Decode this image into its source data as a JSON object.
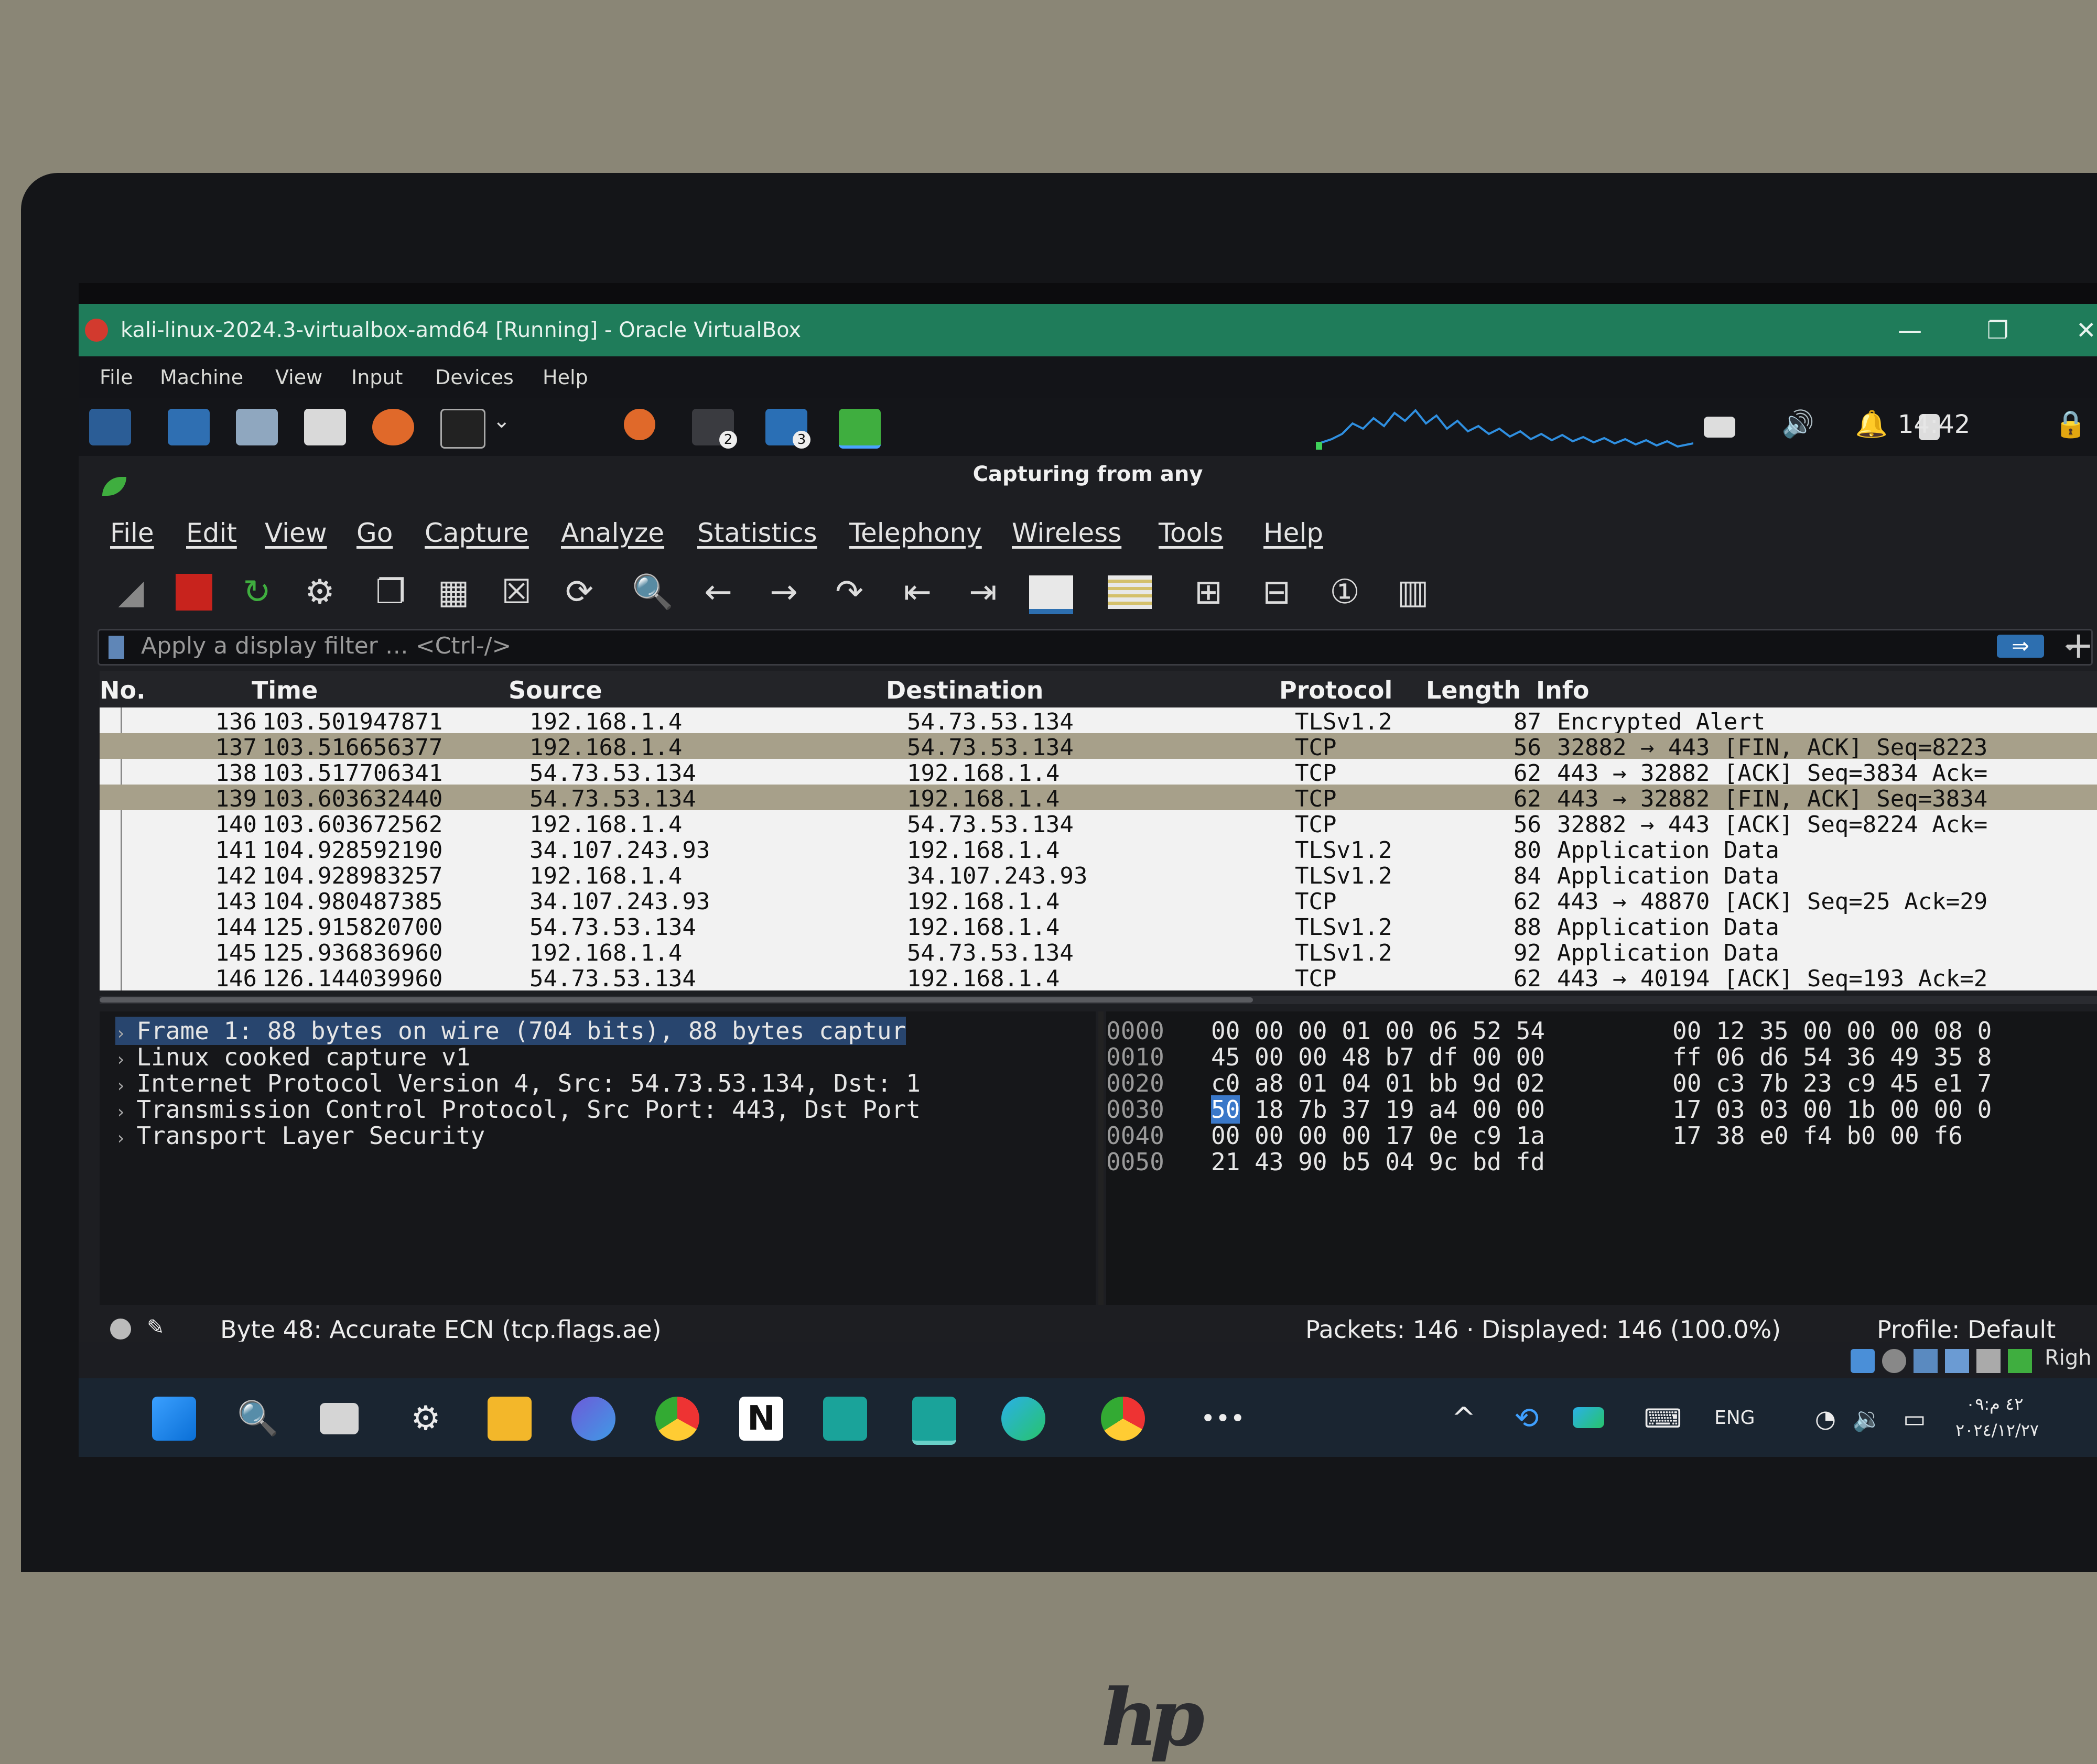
{
  "vbox": {
    "title": "kali-linux-2024.3-virtualbox-amd64 [Running] - Oracle VirtualBox",
    "menu": [
      "File",
      "Machine",
      "View",
      "Input",
      "Devices",
      "Help"
    ],
    "minimize": "—",
    "restore": "❐",
    "close": "✕"
  },
  "kali_panel": {
    "clock": "14:42",
    "workspace_badges": [
      "2",
      "3"
    ]
  },
  "wireshark": {
    "title": "Capturing from any",
    "menu": [
      "File",
      "Edit",
      "View",
      "Go",
      "Capture",
      "Analyze",
      "Statistics",
      "Telephony",
      "Wireless",
      "Tools",
      "Help"
    ],
    "filter_placeholder": "Apply a display filter … <Ctrl-/>",
    "columns": [
      "No.",
      "Time",
      "Source",
      "Destination",
      "Protocol",
      "Length",
      "Info"
    ],
    "packets": [
      {
        "no": "136",
        "time": "103.501947871",
        "src": "192.168.1.4",
        "dst": "54.73.53.134",
        "proto": "TLSv1.2",
        "len": "87",
        "info": "Encrypted Alert"
      },
      {
        "no": "137",
        "time": "103.516656377",
        "src": "192.168.1.4",
        "dst": "54.73.53.134",
        "proto": "TCP",
        "len": "56",
        "info": "32882 → 443 [FIN, ACK] Seq=8223"
      },
      {
        "no": "138",
        "time": "103.517706341",
        "src": "54.73.53.134",
        "dst": "192.168.1.4",
        "proto": "TCP",
        "len": "62",
        "info": "443 → 32882 [ACK] Seq=3834 Ack="
      },
      {
        "no": "139",
        "time": "103.603632440",
        "src": "54.73.53.134",
        "dst": "192.168.1.4",
        "proto": "TCP",
        "len": "62",
        "info": "443 → 32882 [FIN, ACK] Seq=3834"
      },
      {
        "no": "140",
        "time": "103.603672562",
        "src": "192.168.1.4",
        "dst": "54.73.53.134",
        "proto": "TCP",
        "len": "56",
        "info": "32882 → 443 [ACK] Seq=8224 Ack="
      },
      {
        "no": "141",
        "time": "104.928592190",
        "src": "34.107.243.93",
        "dst": "192.168.1.4",
        "proto": "TLSv1.2",
        "len": "80",
        "info": "Application Data"
      },
      {
        "no": "142",
        "time": "104.928983257",
        "src": "192.168.1.4",
        "dst": "34.107.243.93",
        "proto": "TLSv1.2",
        "len": "84",
        "info": "Application Data"
      },
      {
        "no": "143",
        "time": "104.980487385",
        "src": "34.107.243.93",
        "dst": "192.168.1.4",
        "proto": "TCP",
        "len": "62",
        "info": "443 → 48870 [ACK] Seq=25 Ack=29"
      },
      {
        "no": "144",
        "time": "125.915820700",
        "src": "54.73.53.134",
        "dst": "192.168.1.4",
        "proto": "TLSv1.2",
        "len": "88",
        "info": "Application Data"
      },
      {
        "no": "145",
        "time": "125.936836960",
        "src": "192.168.1.4",
        "dst": "54.73.53.134",
        "proto": "TLSv1.2",
        "len": "92",
        "info": "Application Data"
      },
      {
        "no": "146",
        "time": "126.144039960",
        "src": "54.73.53.134",
        "dst": "192.168.1.4",
        "proto": "TCP",
        "len": "62",
        "info": "443 → 40194 [ACK] Seq=193 Ack=2"
      }
    ],
    "details": [
      "Frame 1: 88 bytes on wire (704 bits), 88 bytes captur",
      "Linux cooked capture v1",
      "Internet Protocol Version 4, Src: 54.73.53.134, Dst: 1",
      "Transmission Control Protocol, Src Port: 443, Dst Port",
      "Transport Layer Security"
    ],
    "bytes": [
      {
        "offset": "0000",
        "hex1": "00 00 00 01 00 06 52 54",
        "hex2": "00 12 35 00 00 00 08 0"
      },
      {
        "offset": "0010",
        "hex1": "45 00 00 48 b7 df 00 00",
        "hex2": "ff 06 d6 54 36 49 35 8"
      },
      {
        "offset": "0020",
        "hex1": "c0 a8 01 04 01 bb 9d 02",
        "hex2": "00 c3 7b 23 c9 45 e1 7"
      },
      {
        "offset": "0030",
        "hex_sel": "50",
        "hex1_rest": " 18 7b 37 19 a4 00 00",
        "hex2": "17 03 03 00 1b 00 00 0"
      },
      {
        "offset": "0040",
        "hex1": "00 00 00 00 17 0e c9 1a",
        "hex2": "17 38 e0 f4 b0 00 f6"
      },
      {
        "offset": "0050",
        "hex1": "21 43 90 b5 04 9c bd fd",
        "hex2": ""
      }
    ],
    "status_field": "Byte 48: Accurate ECN (tcp.flags.ae)",
    "status_packets": "Packets: 146 · Displayed: 146 (100.0%)",
    "status_profile": "Profile: Default"
  },
  "host_tray": {
    "right_ctrl": "Righ"
  },
  "taskbar": {
    "more": "•••",
    "chevron": "^",
    "language": "ENG",
    "time": "۰۹:٤٢ م",
    "date": "٢٠٢٤/١٢/٢٧"
  },
  "laptop": {
    "brand": "hp"
  },
  "colors": {
    "vbox_title": "#1f7c5a",
    "packet_highlight": "#a7a08a",
    "selection_blue": "#3a78c9",
    "capture_stop": "#c8231d",
    "wireshark_green": "#3fae3f"
  }
}
